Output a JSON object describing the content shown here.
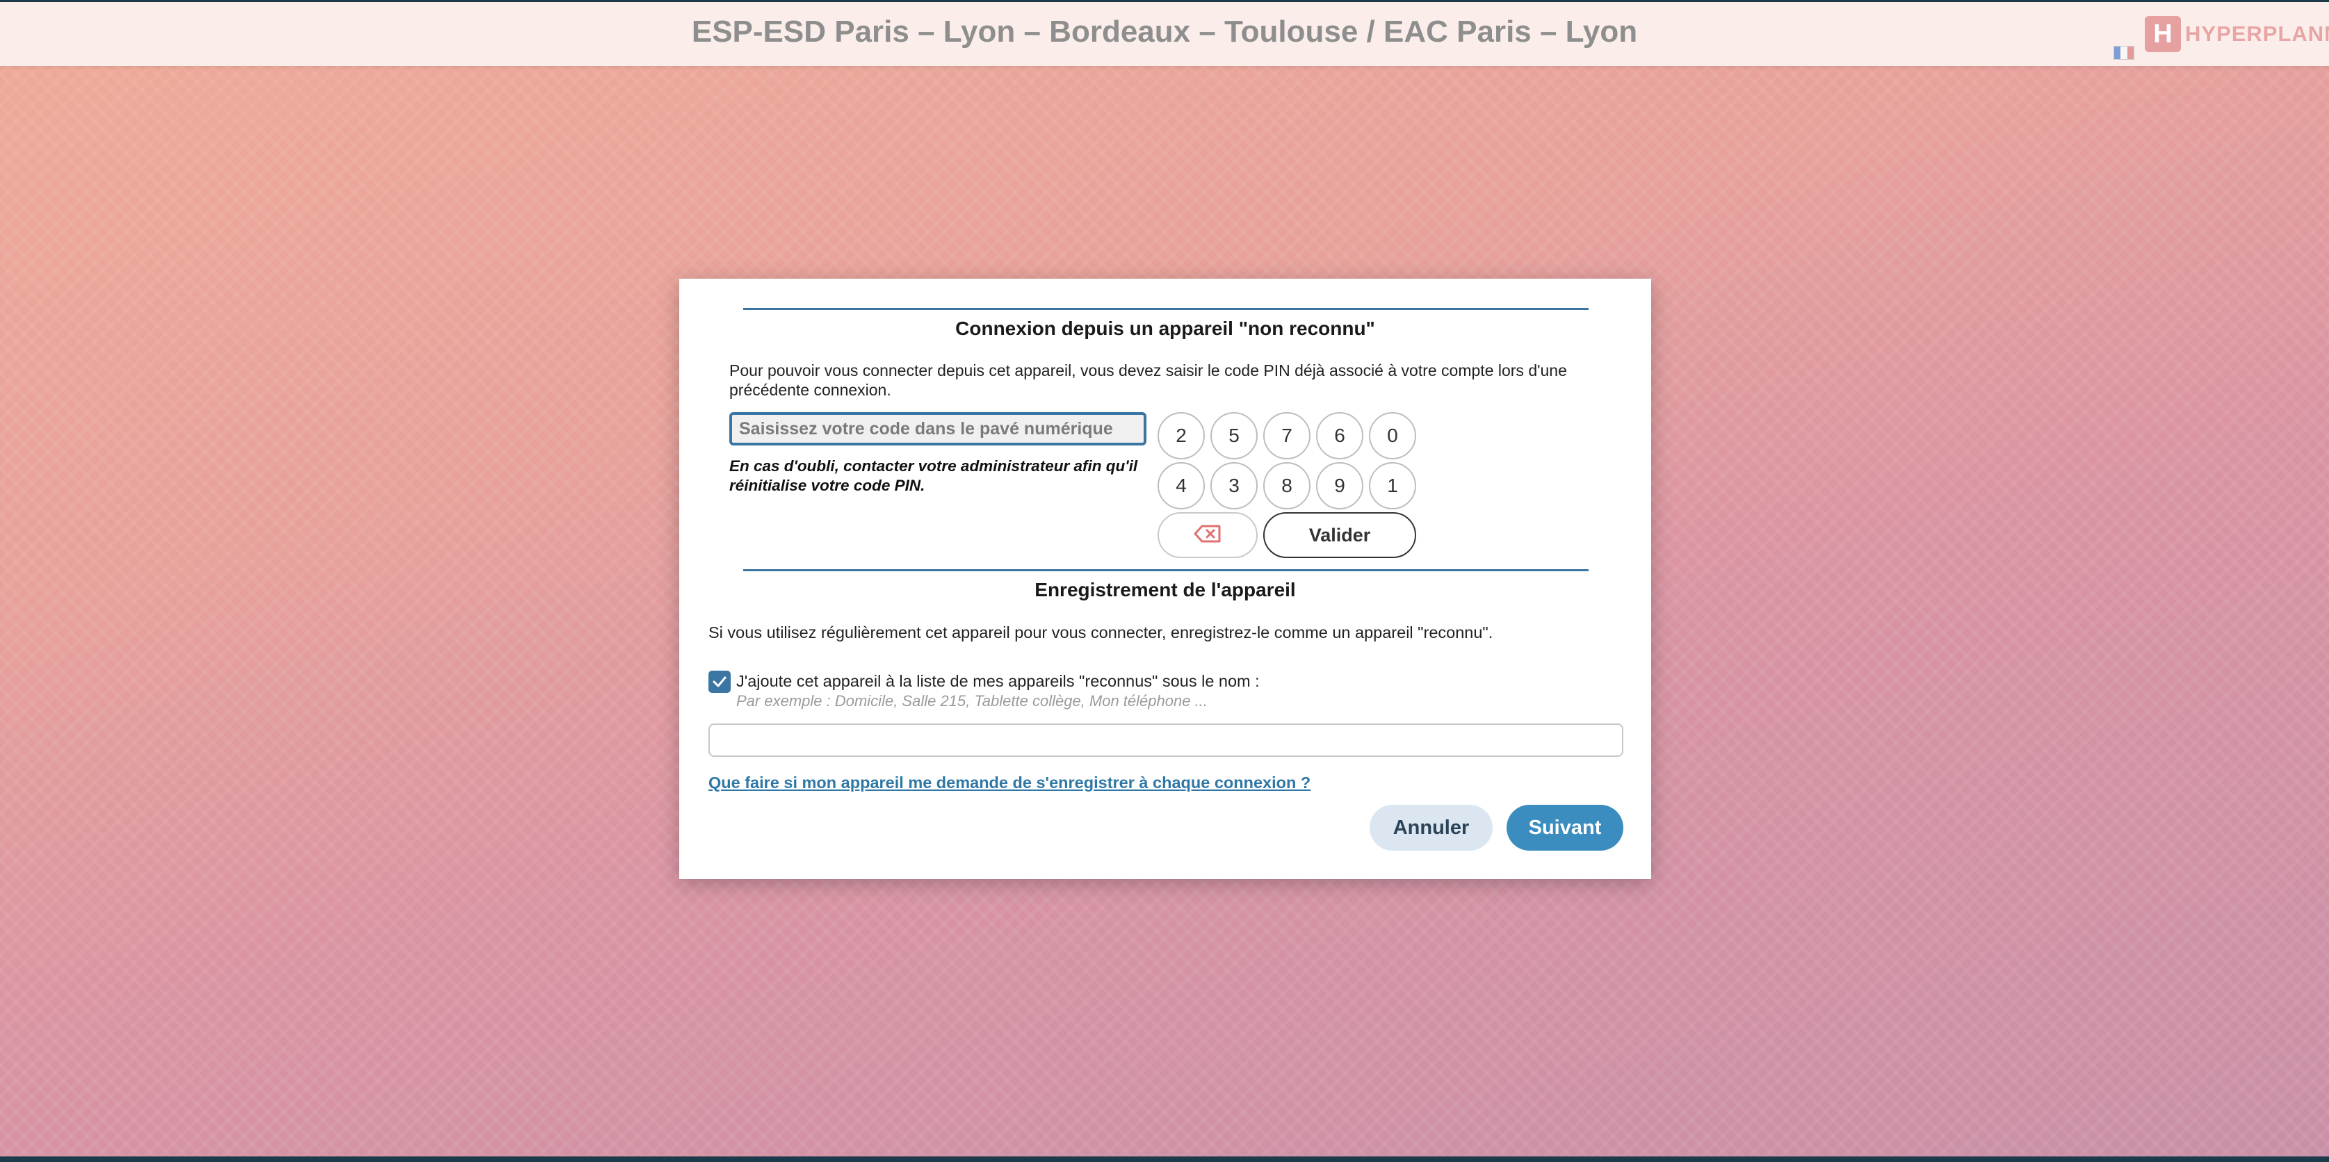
{
  "header": {
    "site_title": "ESP-ESD Paris – Lyon – Bordeaux – Toulouse / EAC Paris – Lyon",
    "logo_letter": "H",
    "logo_text": "HYPERPLANNING",
    "language_icon": "french-flag-icon"
  },
  "dialog": {
    "pin_section": {
      "title": "Connexion depuis un appareil \"non reconnu\"",
      "intro": "Pour pouvoir vous connecter depuis cet appareil, vous devez saisir le code PIN déjà associé à votre compte lors d'une précédente connexion.",
      "input_placeholder": "Saisissez votre code dans le pavé numérique",
      "forgot_note": "En cas d'oubli, contacter votre administrateur afin qu'il réinitialise votre code PIN.",
      "keypad_row1": [
        "2",
        "5",
        "7",
        "6",
        "0"
      ],
      "keypad_row2": [
        "4",
        "3",
        "8",
        "9",
        "1"
      ],
      "erase_icon": "backspace-icon",
      "validate_label": "Valider"
    },
    "register_section": {
      "title": "Enregistrement de l'appareil",
      "text": "Si vous utilisez régulièrement cet appareil pour vous connecter, enregistrez-le comme un appareil \"reconnu\".",
      "checkbox_checked": true,
      "checkbox_label": "J'ajoute cet appareil à la liste de mes appareils \"reconnus\" sous le nom :",
      "hint": "Par exemple : Domicile, Salle 215, Tablette collège, Mon téléphone ...",
      "device_name_value": "",
      "help_link": "Que faire si mon appareil me demande de s'enregistrer à chaque connexion ?"
    },
    "actions": {
      "cancel_label": "Annuler",
      "next_label": "Suivant"
    }
  },
  "colors": {
    "accent": "#3b76a3",
    "primary_button": "#3b8dbf",
    "secondary_button": "#dbe6f0",
    "logo": "#e6a0a0"
  }
}
